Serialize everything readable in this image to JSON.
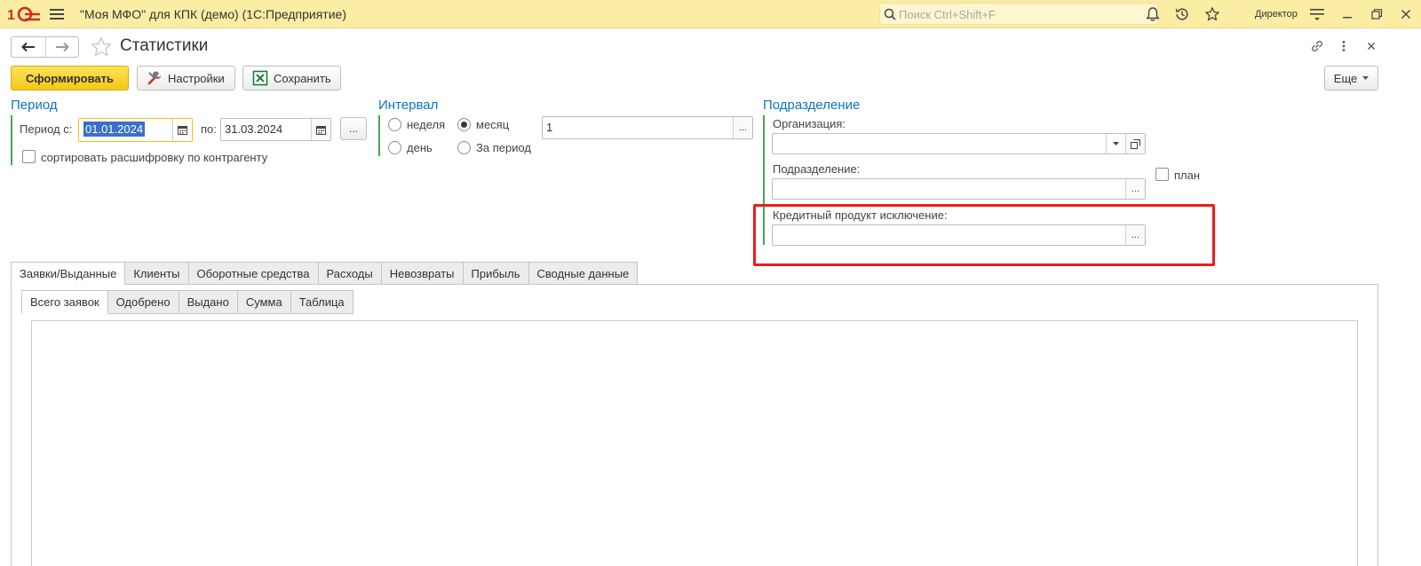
{
  "app": {
    "title": "\"Моя МФО\" для КПК (демо)  (1С:Предприятие)",
    "search_placeholder": "Поиск Ctrl+Shift+F",
    "user": "Директор"
  },
  "page": {
    "title": "Статистики"
  },
  "toolbar": {
    "generate": "Сформировать",
    "settings": "Настройки",
    "save": "Сохранить",
    "more": "Еще"
  },
  "period": {
    "title": "Период",
    "from_label": "Период с:",
    "from_value": "01.01.2024",
    "to_label": "по:",
    "to_value": "31.03.2024",
    "ellipsis": "...",
    "sort_label": "сортировать расшифровку по контрагенту"
  },
  "interval": {
    "title": "Интервал",
    "options": [
      "неделя",
      "месяц",
      "день",
      "За период"
    ],
    "selected": "месяц",
    "count_value": "1"
  },
  "division": {
    "title": "Подразделение",
    "org_label": "Организация:",
    "org_value": "",
    "div_label": "Подразделение:",
    "div_value": "",
    "plan_label": "план",
    "credit_label": "Кредитный продукт исключение:",
    "credit_value": ""
  },
  "tabs": [
    "Заявки/Выданные",
    "Клиенты",
    "Оборотные средства",
    "Расходы",
    "Невозвраты",
    "Прибыль",
    "Сводные данные"
  ],
  "subtabs": [
    "Всего заявок",
    "Одобрено",
    "Выдано",
    "Сумма",
    "Таблица"
  ],
  "colors": {
    "titlebar": "#fbeda3",
    "accent_blue": "#0a74c4",
    "group_bar": "#4aa35a",
    "highlight": "#ee1c1c",
    "primary_button": "#f4c916"
  }
}
